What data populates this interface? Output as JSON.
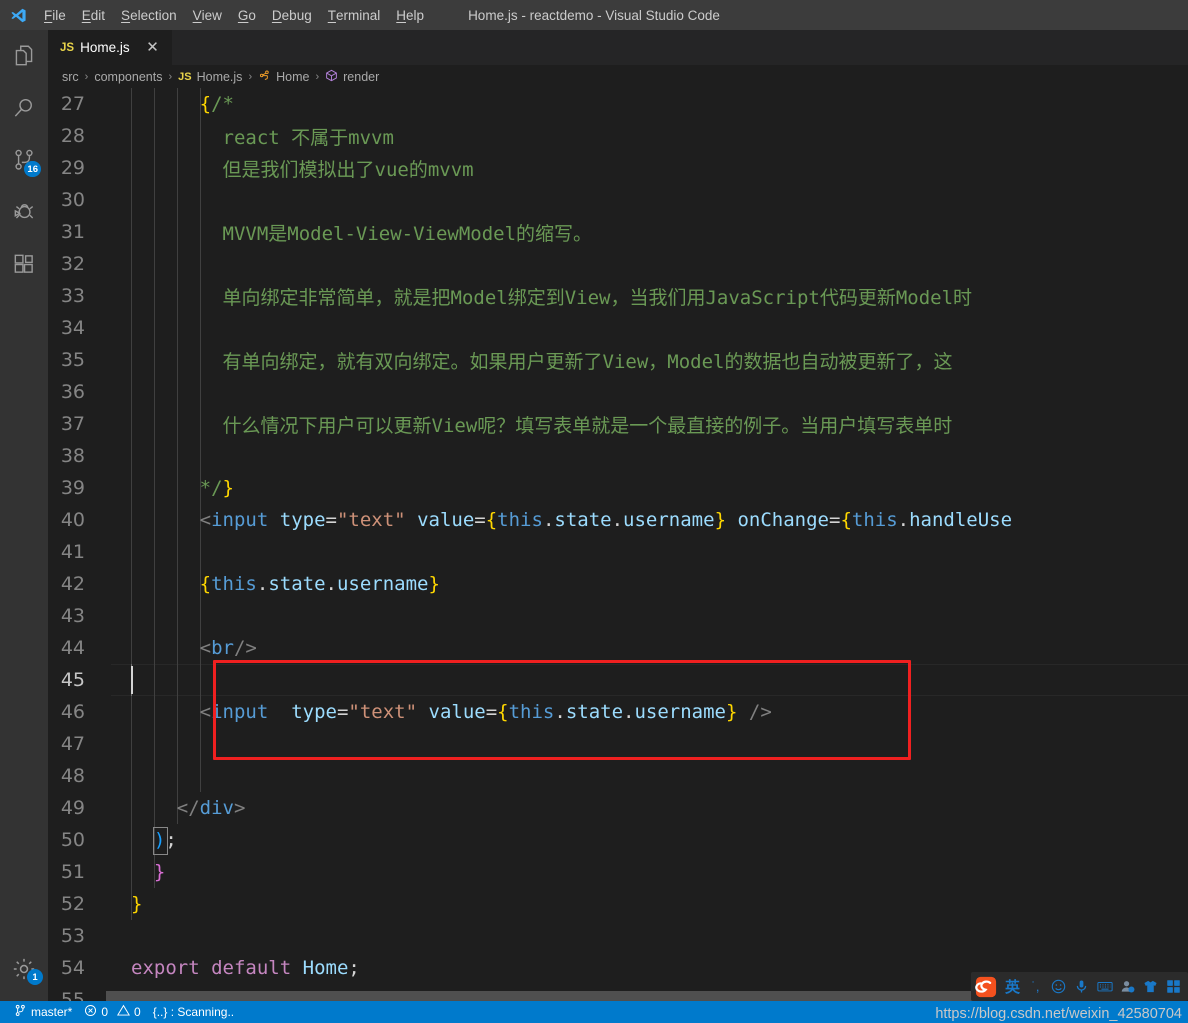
{
  "window": {
    "title": "Home.js - reactdemo - Visual Studio Code"
  },
  "menubar": {
    "items": [
      {
        "label": "File",
        "mnemonic": "F",
        "rest": "ile"
      },
      {
        "label": "Edit",
        "mnemonic": "E",
        "rest": "dit"
      },
      {
        "label": "Selection",
        "mnemonic": "S",
        "rest": "election"
      },
      {
        "label": "View",
        "mnemonic": "V",
        "rest": "iew"
      },
      {
        "label": "Go",
        "mnemonic": "G",
        "rest": "o"
      },
      {
        "label": "Debug",
        "mnemonic": "D",
        "rest": "ebug"
      },
      {
        "label": "Terminal",
        "mnemonic": "T",
        "rest": "erminal"
      },
      {
        "label": "Help",
        "mnemonic": "H",
        "rest": "elp"
      }
    ]
  },
  "activitybar": {
    "items": [
      {
        "name": "explorer-icon",
        "title": "Explorer",
        "badge": ""
      },
      {
        "name": "search-icon",
        "title": "Search",
        "badge": ""
      },
      {
        "name": "source-control-icon",
        "title": "Source Control",
        "badge": "16"
      },
      {
        "name": "debug-icon",
        "title": "Debug",
        "badge": ""
      },
      {
        "name": "extensions-icon",
        "title": "Extensions",
        "badge": ""
      }
    ],
    "settings": {
      "name": "settings-gear-icon",
      "badge": "1"
    }
  },
  "tabs": [
    {
      "file_type": "JS",
      "label": "Home.js",
      "close": "✕",
      "active": true
    }
  ],
  "breadcrumb": {
    "items": [
      {
        "label": "src",
        "icon": ""
      },
      {
        "label": "components",
        "icon": ""
      },
      {
        "label": "Home.js",
        "icon": "JS"
      },
      {
        "label": "Home",
        "icon": "class"
      },
      {
        "label": "render",
        "icon": "method"
      }
    ],
    "separator": "›"
  },
  "editor": {
    "active_line": 45,
    "first_line": 27,
    "lines": [
      {
        "n": 27,
        "segments": [
          {
            "t": "      ",
            "c": "c-plain"
          },
          {
            "t": "{",
            "c": "c-brace1"
          },
          {
            "t": "/*",
            "c": "c-comment"
          }
        ]
      },
      {
        "n": 28,
        "segments": [
          {
            "t": "        react 不属于mvvm",
            "c": "c-comment"
          }
        ]
      },
      {
        "n": 29,
        "segments": [
          {
            "t": "        但是我们模拟出了vue的mvvm",
            "c": "c-comment"
          }
        ]
      },
      {
        "n": 30,
        "segments": []
      },
      {
        "n": 31,
        "segments": [
          {
            "t": "        MVVM是Model-View-ViewModel的缩写。",
            "c": "c-comment"
          }
        ]
      },
      {
        "n": 32,
        "segments": []
      },
      {
        "n": 33,
        "segments": [
          {
            "t": "        单向绑定非常简单，就是把Model绑定到View，当我们用JavaScript代码更新Model时",
            "c": "c-comment"
          }
        ]
      },
      {
        "n": 34,
        "segments": []
      },
      {
        "n": 35,
        "segments": [
          {
            "t": "        有单向绑定，就有双向绑定。如果用户更新了View，Model的数据也自动被更新了，这",
            "c": "c-comment"
          }
        ]
      },
      {
        "n": 36,
        "segments": []
      },
      {
        "n": 37,
        "segments": [
          {
            "t": "        什么情况下用户可以更新View呢？填写表单就是一个最直接的例子。当用户填写表单时",
            "c": "c-comment"
          }
        ]
      },
      {
        "n": 38,
        "segments": []
      },
      {
        "n": 39,
        "segments": [
          {
            "t": "      ",
            "c": "c-plain"
          },
          {
            "t": "*/",
            "c": "c-comment"
          },
          {
            "t": "}",
            "c": "c-brace1"
          }
        ]
      },
      {
        "n": 40,
        "segments": [
          {
            "t": "      ",
            "c": "c-plain"
          },
          {
            "t": "<",
            "c": "c-punct"
          },
          {
            "t": "input",
            "c": "c-tag"
          },
          {
            "t": " ",
            "c": "c-plain"
          },
          {
            "t": "type",
            "c": "c-attr"
          },
          {
            "t": "=",
            "c": "c-plain"
          },
          {
            "t": "\"text\"",
            "c": "c-string"
          },
          {
            "t": " ",
            "c": "c-plain"
          },
          {
            "t": "value",
            "c": "c-attr"
          },
          {
            "t": "=",
            "c": "c-plain"
          },
          {
            "t": "{",
            "c": "c-brace1"
          },
          {
            "t": "this",
            "c": "c-this"
          },
          {
            "t": ".",
            "c": "c-dot"
          },
          {
            "t": "state",
            "c": "c-prop"
          },
          {
            "t": ".",
            "c": "c-dot"
          },
          {
            "t": "username",
            "c": "c-prop"
          },
          {
            "t": "}",
            "c": "c-brace1"
          },
          {
            "t": " ",
            "c": "c-plain"
          },
          {
            "t": "onChange",
            "c": "c-attr"
          },
          {
            "t": "=",
            "c": "c-plain"
          },
          {
            "t": "{",
            "c": "c-brace1"
          },
          {
            "t": "this",
            "c": "c-this"
          },
          {
            "t": ".",
            "c": "c-dot"
          },
          {
            "t": "handleUse",
            "c": "c-prop"
          }
        ]
      },
      {
        "n": 41,
        "segments": []
      },
      {
        "n": 42,
        "segments": [
          {
            "t": "      ",
            "c": "c-plain"
          },
          {
            "t": "{",
            "c": "c-brace1"
          },
          {
            "t": "this",
            "c": "c-this"
          },
          {
            "t": ".",
            "c": "c-dot"
          },
          {
            "t": "state",
            "c": "c-prop"
          },
          {
            "t": ".",
            "c": "c-dot"
          },
          {
            "t": "username",
            "c": "c-prop"
          },
          {
            "t": "}",
            "c": "c-brace1"
          }
        ]
      },
      {
        "n": 43,
        "segments": []
      },
      {
        "n": 44,
        "segments": [
          {
            "t": "      ",
            "c": "c-plain"
          },
          {
            "t": "<",
            "c": "c-punct"
          },
          {
            "t": "br",
            "c": "c-tag"
          },
          {
            "t": "/>",
            "c": "c-punct"
          }
        ]
      },
      {
        "n": 45,
        "segments": []
      },
      {
        "n": 46,
        "segments": [
          {
            "t": "      ",
            "c": "c-plain"
          },
          {
            "t": "<",
            "c": "c-punct"
          },
          {
            "t": "input",
            "c": "c-tag"
          },
          {
            "t": "  ",
            "c": "c-plain"
          },
          {
            "t": "type",
            "c": "c-attr"
          },
          {
            "t": "=",
            "c": "c-plain"
          },
          {
            "t": "\"text\"",
            "c": "c-string"
          },
          {
            "t": " ",
            "c": "c-plain"
          },
          {
            "t": "value",
            "c": "c-attr"
          },
          {
            "t": "=",
            "c": "c-plain"
          },
          {
            "t": "{",
            "c": "c-brace1"
          },
          {
            "t": "this",
            "c": "c-this"
          },
          {
            "t": ".",
            "c": "c-dot"
          },
          {
            "t": "state",
            "c": "c-prop"
          },
          {
            "t": ".",
            "c": "c-dot"
          },
          {
            "t": "username",
            "c": "c-prop"
          },
          {
            "t": "}",
            "c": "c-brace1"
          },
          {
            "t": " ",
            "c": "c-plain"
          },
          {
            "t": "/>",
            "c": "c-punct"
          }
        ]
      },
      {
        "n": 47,
        "segments": []
      },
      {
        "n": 48,
        "segments": []
      },
      {
        "n": 49,
        "segments": [
          {
            "t": "    ",
            "c": "c-plain"
          },
          {
            "t": "</",
            "c": "c-punct"
          },
          {
            "t": "div",
            "c": "c-tag"
          },
          {
            "t": ">",
            "c": "c-punct"
          }
        ]
      },
      {
        "n": 50,
        "segments": [
          {
            "t": "  ",
            "c": "c-plain"
          },
          {
            "t": ")",
            "c": "c-brace-b"
          },
          {
            "t": ";",
            "c": "c-plain"
          }
        ]
      },
      {
        "n": 51,
        "segments": [
          {
            "t": "  ",
            "c": "c-plain"
          },
          {
            "t": "}",
            "c": "c-brace-p"
          }
        ]
      },
      {
        "n": 52,
        "segments": [
          {
            "t": "}",
            "c": "c-brace1"
          }
        ]
      },
      {
        "n": 53,
        "segments": []
      },
      {
        "n": 54,
        "segments": [
          {
            "t": "export",
            "c": "c-kw"
          },
          {
            "t": " ",
            "c": "c-plain"
          },
          {
            "t": "default",
            "c": "c-kw"
          },
          {
            "t": " ",
            "c": "c-plain"
          },
          {
            "t": "Home",
            "c": "c-ident"
          },
          {
            "t": ";",
            "c": "c-plain"
          }
        ]
      },
      {
        "n": 55,
        "segments": []
      }
    ],
    "annotation": {
      "color": "#f02020",
      "label": "red-highlight-box-around-input-line-46"
    }
  },
  "statusbar": {
    "branch": "master*",
    "errors": "0",
    "warnings": "0",
    "scanning": "{..} : Scanning..",
    "background": "#007acc"
  },
  "ime": {
    "logo": "S",
    "mode": "英",
    "buttons": [
      {
        "name": "punctuation-toggle",
        "glyph": "˙,"
      },
      {
        "name": "emoji-icon",
        "glyph": "☺"
      },
      {
        "name": "voice-input-icon",
        "glyph": "🎤"
      },
      {
        "name": "soft-keyboard-icon",
        "glyph": "⌨"
      },
      {
        "name": "user-account-icon",
        "glyph": "👤"
      },
      {
        "name": "skin-icon",
        "glyph": "👕"
      },
      {
        "name": "toolbox-icon",
        "glyph": "▦"
      }
    ]
  },
  "watermark": {
    "text": "https://blog.csdn.net/weixin_42580704"
  }
}
